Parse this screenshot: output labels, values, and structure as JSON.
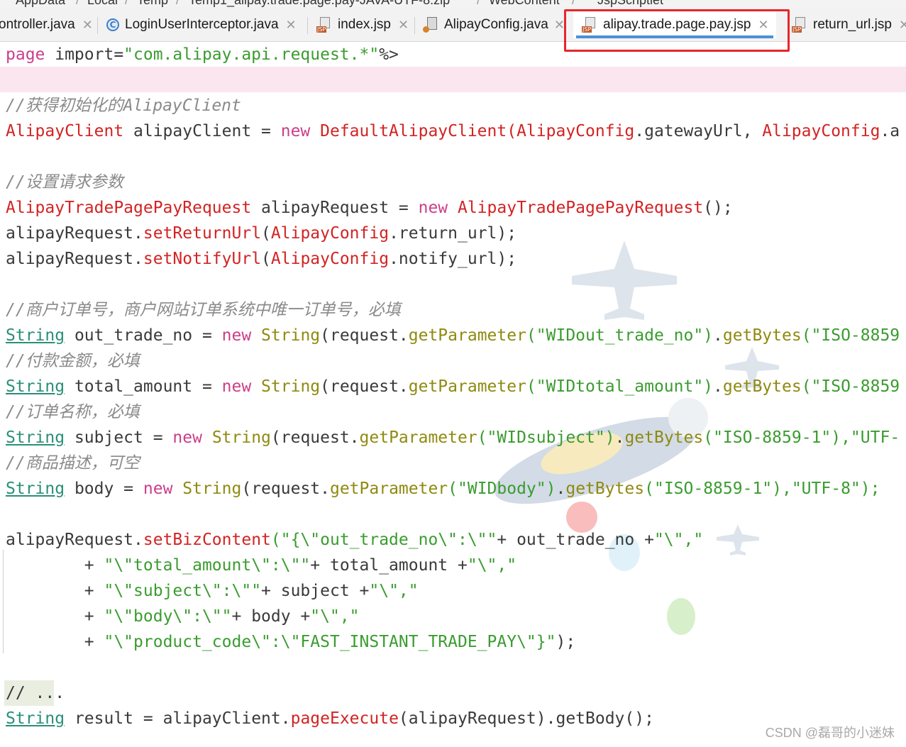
{
  "breadcrumb": [
    "AppData",
    "Local",
    "Temp",
    "Temp1_alipay.trade.page.pay-JAVA-UTF-8.zip",
    "WebContent",
    "JspScriptlet"
  ],
  "tabs": [
    {
      "label": "ontroller.java",
      "icon": "java-class-icon"
    },
    {
      "label": "LoginUserInterceptor.java",
      "icon": "java-class-icon"
    },
    {
      "label": "index.jsp",
      "icon": "jsp-file-icon"
    },
    {
      "label": "AlipayConfig.java",
      "icon": "java-config-icon"
    },
    {
      "label": "alipay.trade.page.pay.jsp",
      "icon": "jsp-file-icon",
      "active": true
    },
    {
      "label": "return_url.jsp",
      "icon": "jsp-file-icon"
    }
  ],
  "code": {
    "l1_page": "page",
    "l1_import": " import=",
    "l1_str": "\"com.alipay.api.request.*\"",
    "l1_end": "%>",
    "c_client": "//获得初始化的AlipayClient",
    "l3_type": "AlipayClient",
    "l3_var": " alipayClient = ",
    "l3_new": "new",
    "l3_ctor": " DefaultAlipayClient(",
    "l3_cfg": "AlipayConfig",
    "l3_rest": ".gatewayUrl, ",
    "l3_cfg2": "AlipayConfig",
    "l3_rest2": ".a",
    "c_params": "//设置请求参数",
    "l5_type": "AlipayTradePagePayRequest",
    "l5_var": " alipayRequest = ",
    "l5_new": "new",
    "l5_ctor": " AlipayTradePagePayRequest",
    "l5_end": "();",
    "l6_obj": "alipayRequest.",
    "l6_fn": "setReturnUrl",
    "l6_p": "(",
    "l6_cfg": "AlipayConfig",
    "l6_rest": ".return_url);",
    "l7_obj": "alipayRequest.",
    "l7_fn": "setNotifyUrl",
    "l7_p": "(",
    "l7_cfg": "AlipayConfig",
    "l7_rest": ".notify_url);",
    "c_order": "//商户订单号，商户网站订单系统中唯一订单号，必填",
    "c_amount": "//付款金额，必填",
    "c_subject": "//订单名称，必填",
    "c_body": "//商品描述，可空",
    "string": "String",
    "new": "new",
    "sl1_var": " out_trade_no = ",
    "sl1_ctor": " String",
    "sl1_a": "(request.",
    "sl1_m": "getParameter",
    "sl1_s": "(\"WIDout_trade_no\")",
    "sl1_b": ".",
    "sl1_m2": "getBytes",
    "sl1_s2": "(\"ISO-8859",
    "sl2_var": " total_amount = ",
    "sl2_s": "(\"WIDtotal_amount\")",
    "sl3_var": " subject = ",
    "sl3_s": "(\"WIDsubject\")",
    "sl3_s2": "(\"ISO-8859-1\"),\"UTF-",
    "sl4_var": " body = ",
    "sl4_s": "(\"WIDbody\")",
    "sl4_s2": "(\"ISO-8859-1\"),\"UTF-8\");",
    "bz_obj": "alipayRequest.",
    "bz_fn": "setBizContent",
    "bz_s1": "(\"{\\\"out_trade_no\\\":\\\"\"",
    "bz_r1": "+ out_trade_no +",
    "bz_s1b": "\"\\\",\"",
    "bz_p2": "        + ",
    "bz_s2": "\"\\\"total_amount\\\":\\\"\"",
    "bz_r2": "+ total_amount +",
    "bz_s2b": "\"\\\",\"",
    "bz_s3": "\"\\\"subject\\\":\\\"\"",
    "bz_r3": "+ subject +",
    "bz_s3b": "\"\\\",\"",
    "bz_s4": "\"\\\"body\\\":\\\"\"",
    "bz_r4": "+ body +",
    "bz_s4b": "\"\\\",\"",
    "bz_s5": "\"\\\"product_code\\\":\\\"FAST_INSTANT_TRADE_PAY\\\"}\"",
    "bz_end": ");",
    "c_more": "// ...",
    "res_var": " result = alipayClient.",
    "res_fn": "pageExecute",
    "res_end": "(alipayRequest).getBody();"
  },
  "watermark": "CSDN @磊哥的小迷妹"
}
